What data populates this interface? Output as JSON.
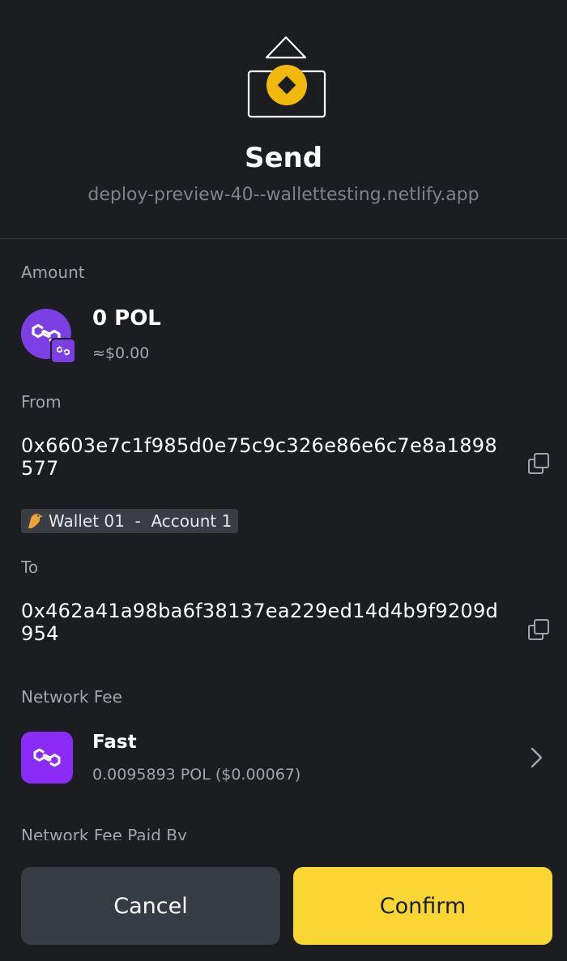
{
  "header": {
    "title": "Send",
    "origin": "deploy-preview-40--wallettesting.netlify.app"
  },
  "amount": {
    "label": "Amount",
    "value": "0 POL",
    "fiat": "≈$0.00",
    "token_icon": "polygon-icon"
  },
  "from": {
    "label": "From",
    "address": "0x6603e7c1f985d0e75c9c326e86e6c7e8a1898577",
    "account_tag": "Wallet 01  -  Account 1",
    "account_emoji": "eagle-icon"
  },
  "to": {
    "label": "To",
    "address": "0x462a41a98ba6f38137ea229ed14d4b9f9209d954"
  },
  "network_fee": {
    "label": "Network Fee",
    "speed": "Fast",
    "amount": "0.0095893 POL ($0.00067)"
  },
  "fee_paid_by": {
    "label": "Network Fee Paid By"
  },
  "footer": {
    "cancel_label": "Cancel",
    "confirm_label": "Confirm"
  },
  "colors": {
    "background": "#1c1d21",
    "accent_yellow": "#fad635",
    "polygon_purple": "#7b3fe4"
  }
}
